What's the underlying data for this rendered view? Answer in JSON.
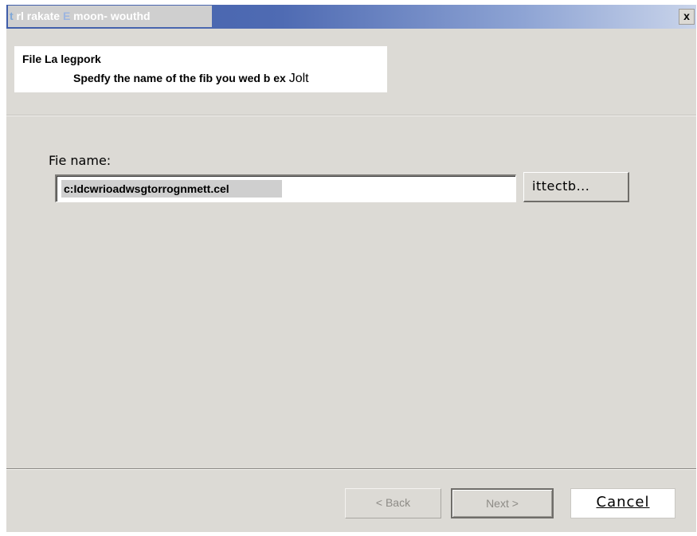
{
  "window": {
    "title_part1": "t",
    "title_part2": " rl rakate ",
    "title_part3": "E",
    "title_part4": " moon- wouthd",
    "close_glyph": "x"
  },
  "header": {
    "title": "File La legpork",
    "subtitle_bold": "Spedfy the name of the fib you wed b ex",
    "subtitle_tail": "Jolt"
  },
  "form": {
    "file_label": "Fie name:",
    "file_value": "c:Idcwrioadwsgtorrognmett.cel",
    "browse_label": "ittectb..."
  },
  "buttons": {
    "back": "< Back",
    "next": "Next >",
    "cancel": "Cancel"
  },
  "colors": {
    "dialog_bg": "#dcdad5",
    "titlebar_start": "#3f5da9",
    "titlebar_end": "#c9d4ea"
  }
}
